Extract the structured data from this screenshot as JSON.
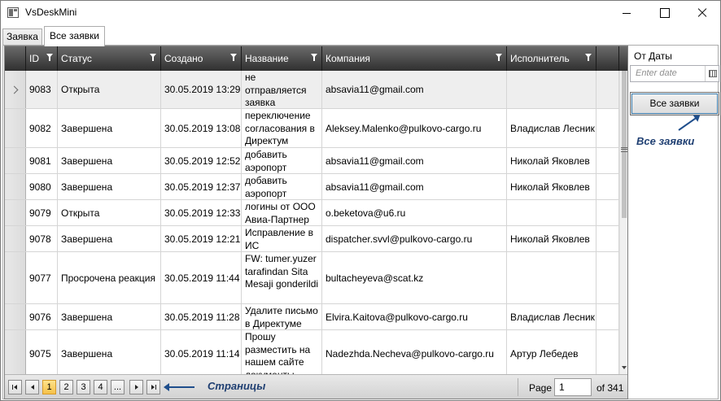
{
  "window": {
    "title": "VsDeskMini"
  },
  "tabs": [
    {
      "label": "Заявка",
      "active": false
    },
    {
      "label": "Все заявки",
      "active": true
    }
  ],
  "grid": {
    "columns": [
      {
        "key": "id",
        "label": "ID"
      },
      {
        "key": "status",
        "label": "Статус"
      },
      {
        "key": "created",
        "label": "Создано"
      },
      {
        "key": "name",
        "label": "Название"
      },
      {
        "key": "company",
        "label": "Компания"
      },
      {
        "key": "assignee",
        "label": "Исполнитель"
      }
    ],
    "rows": [
      {
        "id": "9083",
        "status": "Открыта",
        "created": "30.05.2019 13:29",
        "name": "не отправляется заявка",
        "company": "absavia11@gmail.com",
        "assignee": "",
        "selected": true
      },
      {
        "id": "9082",
        "status": "Завершена",
        "created": "30.05.2019 13:08",
        "name": "переключение согласования в Директум",
        "company": "Aleksey.Malenko@pulkovo-cargo.ru",
        "assignee": "Владислав Лесник",
        "selected": false
      },
      {
        "id": "9081",
        "status": "Завершена",
        "created": "30.05.2019 12:52",
        "name": " добавить аэропорт",
        "company": "absavia11@gmail.com",
        "assignee": "Николай Яковлев",
        "selected": false
      },
      {
        "id": "9080",
        "status": "Завершена",
        "created": "30.05.2019 12:37",
        "name": "добавить аэропорт",
        "company": "absavia11@gmail.com",
        "assignee": "Николай Яковлев",
        "selected": false
      },
      {
        "id": "9079",
        "status": "Открыта",
        "created": "30.05.2019 12:33",
        "name": "логины от ООО Авиа-Партнер",
        "company": "o.beketova@u6.ru",
        "assignee": "",
        "selected": false
      },
      {
        "id": "9078",
        "status": "Завершена",
        "created": "30.05.2019 12:21",
        "name": "Исправление в ИС",
        "company": "dispatcher.svvl@pulkovo-cargo.ru",
        "assignee": "Николай Яковлев",
        "selected": false
      },
      {
        "id": "9077",
        "status": "Просрочена реакция",
        "created": "30.05.2019 11:44",
        "name": "FW: tumer.yuzer tarafindan Sita Mesaji gonderildi",
        "company": "bultacheyeva@scat.kz",
        "assignee": "",
        "selected": false
      },
      {
        "id": "9076",
        "status": "Завершена",
        "created": "30.05.2019 11:28",
        "name": "Удалите письмо в Директуме",
        "company": "Elvira.Kaitova@pulkovo-cargo.ru",
        "assignee": "Владислав Лесник",
        "selected": false
      },
      {
        "id": "9075",
        "status": "Завершена",
        "created": "30.05.2019 11:14",
        "name": "Прошу разместить на нашем сайте документы",
        "company": "Nadezhda.Necheva@pulkovo-cargo.ru",
        "assignee": "Артур Лебедев",
        "selected": false
      }
    ]
  },
  "pager": {
    "pages": [
      "1",
      "2",
      "3",
      "4",
      "..."
    ],
    "current_page": "1",
    "page_label": "Page",
    "page_value": "1",
    "of_label": "of 341",
    "annotation": "Страницы"
  },
  "side_panel": {
    "from_date_label": "От Даты",
    "date_placeholder": "Enter date",
    "all_button_label": "Все заявки",
    "annotation": "Все заявки"
  },
  "colors": {
    "header_bg": "#3a3a3a",
    "annotation": "#1f3f72",
    "active_page": "#f6c14a"
  }
}
